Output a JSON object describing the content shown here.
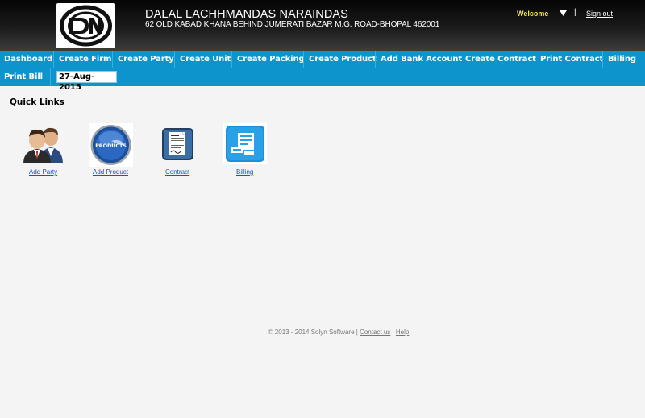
{
  "header": {
    "company_name": "DALAL LACHHMANDAS NARAINDAS",
    "company_address": "62 OLD KABAD KHANA BEHIND JUMERATI BAZAR M.G. ROAD-BHOPAL 462001",
    "welcome": "Welcome",
    "separator": "|",
    "sign_out": "Sign out",
    "logo_icon": "dn-monogram-logo"
  },
  "nav": {
    "items": [
      {
        "label": "Dashboard"
      },
      {
        "label": "Create Firm"
      },
      {
        "label": "Create Party"
      },
      {
        "label": "Create Unit"
      },
      {
        "label": "Create Packing"
      },
      {
        "label": "Create Product"
      },
      {
        "label": "Add Bank Account"
      },
      {
        "label": "Create Contract"
      },
      {
        "label": "Print Contract"
      },
      {
        "label": "Billing"
      },
      {
        "label": "Print Bill"
      }
    ],
    "date": "27-Aug-2015"
  },
  "quick_links": {
    "title": "Quick Links",
    "items": [
      {
        "label": "Add Party",
        "icon": "users-icon"
      },
      {
        "label": "Add Product",
        "icon": "products-icon",
        "icon_text": "PRODUCTS"
      },
      {
        "label": "Contract",
        "icon": "contract-document-icon"
      },
      {
        "label": "Billing",
        "icon": "billing-icon"
      }
    ]
  },
  "footer": {
    "copyright": "© 2013 - 2014 Solyn Software |",
    "contact": "Contact us",
    "separator": "|",
    "help": "Help"
  },
  "colors": {
    "nav_bg": "#0d94cc",
    "welcome_text": "#f1e55a",
    "link_blue": "#1a55c4",
    "page_bg": "#f4f4f4"
  }
}
